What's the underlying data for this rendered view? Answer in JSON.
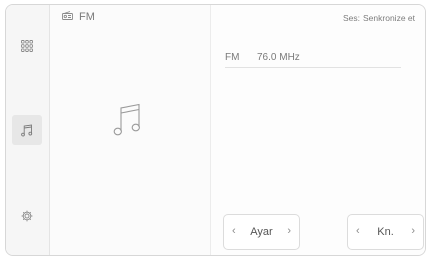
{
  "header": {
    "source_icon": "radio-icon",
    "source_label": "FM"
  },
  "sidebar": {
    "items": [
      {
        "name": "apps",
        "icon": "grid-icon"
      },
      {
        "name": "media",
        "icon": "music-note-icon",
        "active": true
      },
      {
        "name": "settings",
        "icon": "gear-icon"
      }
    ]
  },
  "sound": {
    "label": "Ses:",
    "value": "Senkronize et"
  },
  "station": {
    "band": "FM",
    "frequency": "76.0 MHz"
  },
  "controls": {
    "setup_label": "Ayar",
    "channel_label": "Kn.",
    "prev_glyph": "‹",
    "next_glyph": "›"
  },
  "colors": {
    "background": "#ffffff",
    "sidebar": "#f6f6f6",
    "active_item": "#e7e7e7",
    "text": "#6f6f6f",
    "divider": "#e2e2e2"
  }
}
